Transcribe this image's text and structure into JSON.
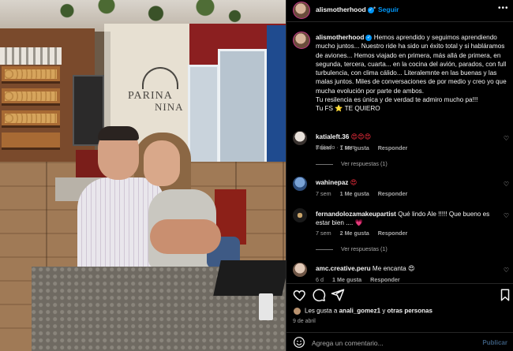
{
  "post": {
    "username": "alismotherhood",
    "follow_label": "Seguir",
    "photo_sign_line1": "PARINA",
    "photo_sign_line2": "NINA",
    "caption_text": "Hemos aprendido y seguimos aprendiendo mucho juntos... Nuestro ride ha sido un éxito total y si habláramos de aviones... Hemos viajado en primera, más allá de primera, en segunda, tercera, cuarta... en la cocina del avión, parados, con full turbulencia, con clima cálido... Literalemnte en las buenas y las malas juntos. Miles de conversaciones de por medio y creo yo que mucha evolución por parte de ambos.",
    "caption_line2": "Tu resilencia es única y de verdad te admiro mucho pa!!!",
    "caption_line3_pre": "Tu FS",
    "caption_line3_star": "⭐",
    "caption_line3_post": "TE QUIERO",
    "caption_meta": "Editado · 7 sem"
  },
  "comments": [
    {
      "username": "katialeft.36",
      "text": "😍😍😍",
      "time": "7 sem",
      "likes": "1 Me gusta",
      "reply": "Responder",
      "replies": "Ver respuestas (1)"
    },
    {
      "username": "wahinepaz",
      "text": "😍",
      "time": "7 sem",
      "likes": "1 Me gusta",
      "reply": "Responder",
      "replies": ""
    },
    {
      "username": "fernandolozamakeupartist",
      "text": "Qué lindo Ale !!!!! Que bueno es estar bien .... 💗",
      "time": "7 sem",
      "likes": "2 Me gusta",
      "reply": "Responder",
      "replies": "Ver respuestas (1)"
    },
    {
      "username": "amc.creative.peru",
      "text": "Me encanta 😍",
      "time": "6 d",
      "likes": "1 Me gusta",
      "reply": "Responder",
      "replies": ""
    }
  ],
  "likes_summary": {
    "prefix": "Les gusta a",
    "user": "anali_gomez1",
    "middle": "y",
    "others": "otras personas"
  },
  "date": "9 de abril",
  "add_comment": {
    "placeholder": "Agrega un comentario...",
    "post_label": "Publicar"
  },
  "icons": {
    "more": "more-icon",
    "like": "heart-icon",
    "comment": "comment-icon",
    "share": "send-icon",
    "save": "bookmark-icon",
    "emoji": "emoji-icon"
  },
  "colors": {
    "accent": "#0095f6",
    "like": "#ff3040",
    "muted": "#a8a8a8",
    "background": "#000000"
  }
}
